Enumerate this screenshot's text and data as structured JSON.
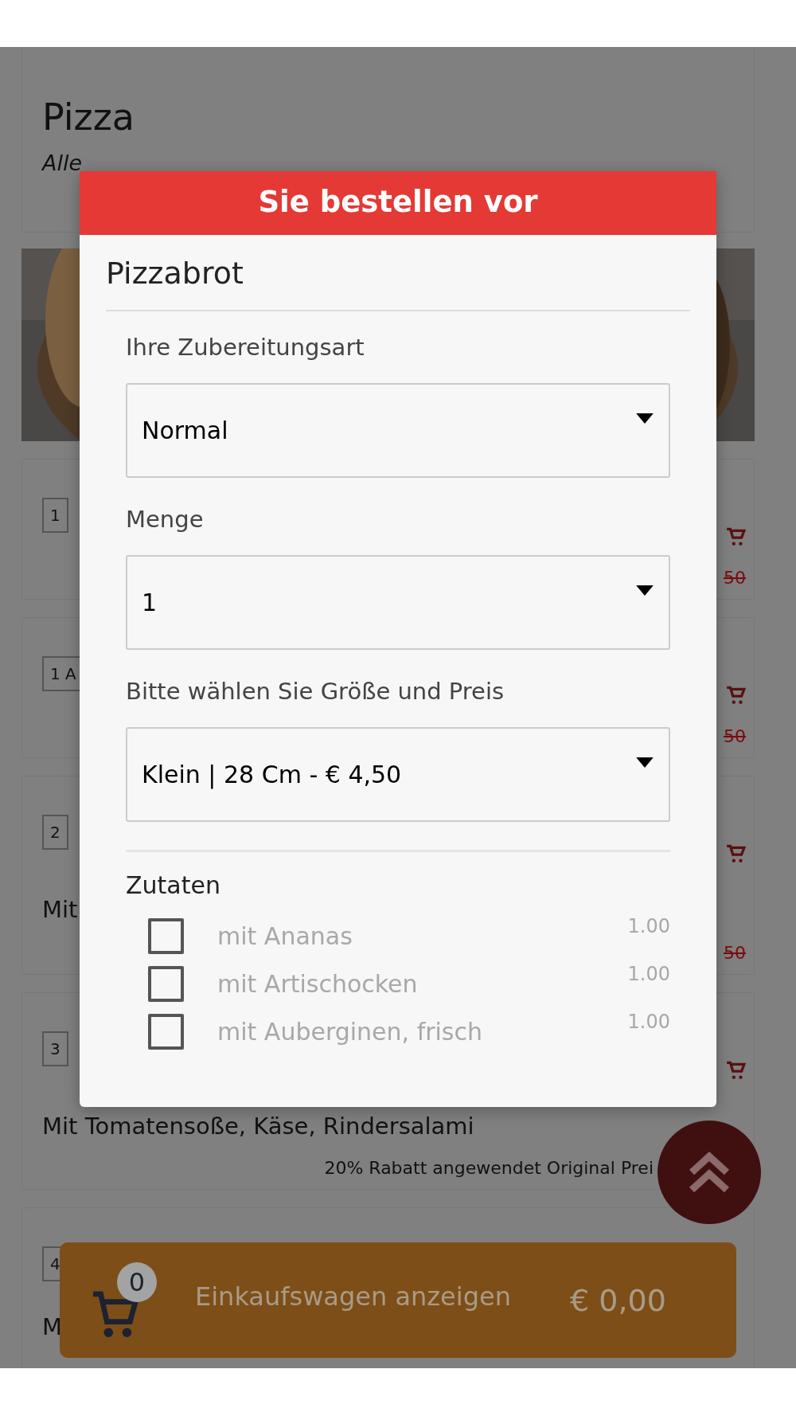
{
  "page": {
    "title": "Pizza",
    "subtitle": "Alle"
  },
  "menu_items": [
    {
      "badge": "1",
      "price": "50"
    },
    {
      "badge": "1 A",
      "price": "50"
    },
    {
      "badge": "2",
      "description": "Mit",
      "price": "50"
    },
    {
      "badge": "3",
      "description": "Mit Tomatensoße, Käse, Rindersalami",
      "discount_note": "20% Rabatt angewendet Original Prei"
    },
    {
      "badge": "4",
      "description": "M"
    }
  ],
  "dialog": {
    "header": "Sie bestellen vor",
    "title": "Pizzabrot",
    "selects": [
      {
        "label": "Ihre Zubereitungsart",
        "value": "Normal"
      },
      {
        "label": "Menge",
        "value": "1"
      },
      {
        "label": "Bitte wählen Sie Größe und Preis",
        "value": "Klein | 28 Cm - € 4,50"
      }
    ],
    "extras_title": "Zutaten",
    "extras": [
      {
        "label": "mit Ananas",
        "price": "1.00",
        "checked": false
      },
      {
        "label": "mit Artischocken",
        "price": "1.00",
        "checked": false
      },
      {
        "label": "mit Auberginen, frisch",
        "price": "1.00",
        "checked": false
      }
    ]
  },
  "cart_bar": {
    "count": "0",
    "label": "Einkaufswagen anzeigen",
    "total": "€ 0,00"
  }
}
